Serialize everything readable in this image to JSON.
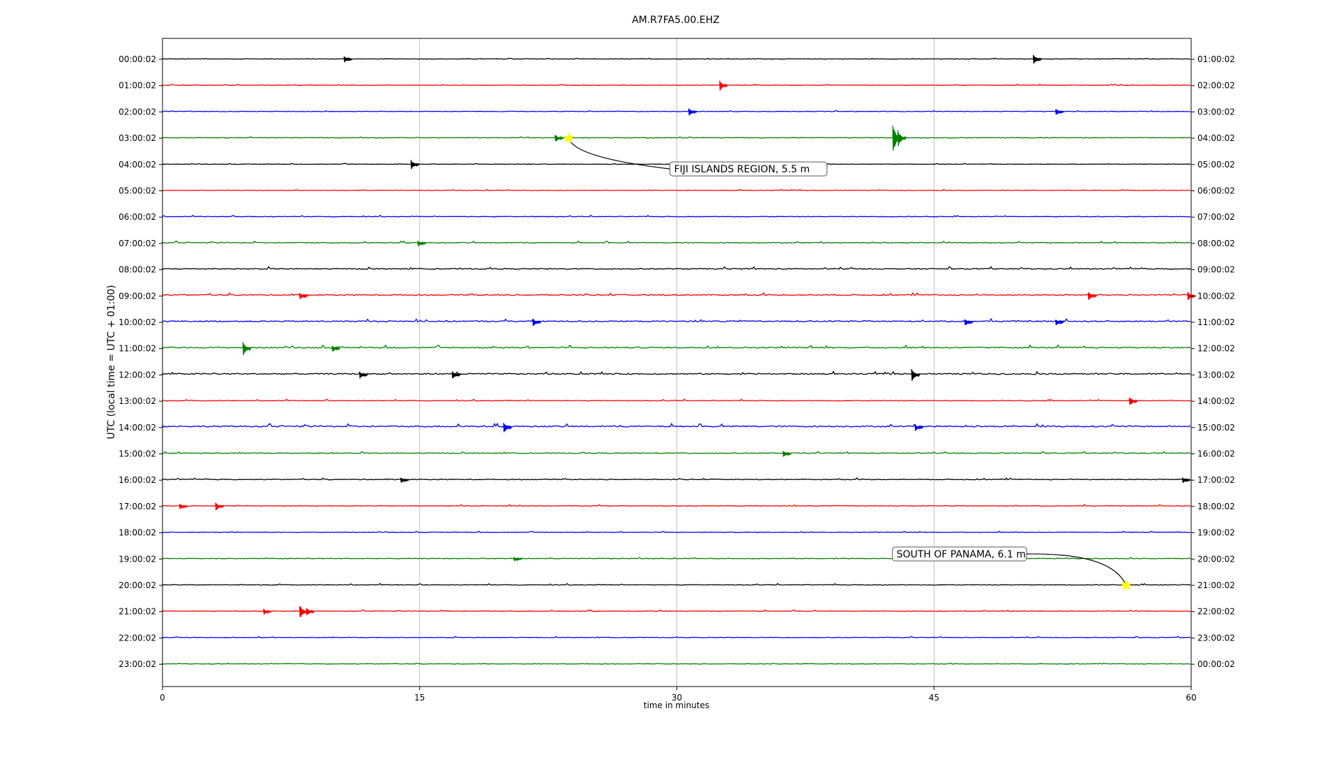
{
  "chart_data": {
    "type": "line",
    "title": "AM.R7FA5.00.EHZ",
    "xlabel": "time in minutes",
    "ylabel": "UTC (local time = UTC + 01:00)",
    "xlim": [
      0,
      60
    ],
    "x_ticks": [
      "0",
      "15",
      "30",
      "45",
      "60"
    ],
    "x_tick_values": [
      0,
      15,
      30,
      45,
      60
    ],
    "grid": "vertical",
    "trace_colors": [
      "#000000",
      "#ff0000",
      "#0000ff",
      "#008000"
    ],
    "left_labels": [
      "00:00:02",
      "01:00:02",
      "02:00:02",
      "03:00:02",
      "04:00:02",
      "05:00:02",
      "06:00:02",
      "07:00:02",
      "08:00:02",
      "09:00:02",
      "10:00:02",
      "11:00:02",
      "12:00:02",
      "13:00:02",
      "14:00:02",
      "15:00:02",
      "16:00:02",
      "17:00:02",
      "18:00:02",
      "19:00:02",
      "20:00:02",
      "21:00:02",
      "22:00:02",
      "23:00:02"
    ],
    "right_labels": [
      "01:00:02",
      "02:00:02",
      "03:00:02",
      "04:00:02",
      "05:00:02",
      "06:00:02",
      "07:00:02",
      "08:00:02",
      "09:00:02",
      "10:00:02",
      "11:00:02",
      "12:00:02",
      "13:00:02",
      "14:00:02",
      "15:00:02",
      "16:00:02",
      "17:00:02",
      "18:00:02",
      "19:00:02",
      "20:00:02",
      "21:00:02",
      "22:00:02",
      "23:00:02",
      "00:00:02"
    ],
    "noise_levels": [
      0.6,
      0.7,
      0.8,
      0.8,
      0.6,
      0.8,
      0.9,
      1.2,
      1.5,
      1.8,
      1.8,
      1.8,
      1.8,
      1.0,
      2.0,
      1.2,
      1.2,
      1.0,
      0.8,
      0.9,
      0.9,
      0.9,
      0.8,
      0.7
    ],
    "spikes": [
      {
        "trace": 0,
        "minute": 10.6,
        "amp": 5
      },
      {
        "trace": 0,
        "minute": 50.8,
        "amp": 8
      },
      {
        "trace": 1,
        "minute": 32.5,
        "amp": 7
      },
      {
        "trace": 2,
        "minute": 30.7,
        "amp": 6
      },
      {
        "trace": 2,
        "minute": 52.1,
        "amp": 5
      },
      {
        "trace": 3,
        "minute": 22.9,
        "amp": 6
      },
      {
        "trace": 3,
        "minute": 42.6,
        "amp": 22
      },
      {
        "trace": 3,
        "minute": 42.9,
        "amp": 12
      },
      {
        "trace": 4,
        "minute": 14.5,
        "amp": 7
      },
      {
        "trace": 7,
        "minute": 14.9,
        "amp": 4
      },
      {
        "trace": 9,
        "minute": 8.0,
        "amp": 5
      },
      {
        "trace": 9,
        "minute": 54.0,
        "amp": 6
      },
      {
        "trace": 9,
        "minute": 59.8,
        "amp": 6
      },
      {
        "trace": 10,
        "minute": 21.6,
        "amp": 6
      },
      {
        "trace": 10,
        "minute": 46.8,
        "amp": 5
      },
      {
        "trace": 10,
        "minute": 52.1,
        "amp": 5
      },
      {
        "trace": 11,
        "minute": 4.7,
        "amp": 10
      },
      {
        "trace": 11,
        "minute": 9.9,
        "amp": 5
      },
      {
        "trace": 12,
        "minute": 11.5,
        "amp": 5
      },
      {
        "trace": 12,
        "minute": 16.9,
        "amp": 6
      },
      {
        "trace": 12,
        "minute": 43.7,
        "amp": 10
      },
      {
        "trace": 13,
        "minute": 56.4,
        "amp": 7
      },
      {
        "trace": 14,
        "minute": 19.9,
        "amp": 7
      },
      {
        "trace": 14,
        "minute": 43.9,
        "amp": 5
      },
      {
        "trace": 15,
        "minute": 36.2,
        "amp": 5
      },
      {
        "trace": 16,
        "minute": 13.9,
        "amp": 4
      },
      {
        "trace": 16,
        "minute": 59.5,
        "amp": 4
      },
      {
        "trace": 17,
        "minute": 3.1,
        "amp": 6
      },
      {
        "trace": 17,
        "minute": 1.0,
        "amp": 4
      },
      {
        "trace": 19,
        "minute": 20.5,
        "amp": 3
      },
      {
        "trace": 21,
        "minute": 5.9,
        "amp": 4
      },
      {
        "trace": 21,
        "minute": 8.0,
        "amp": 10
      },
      {
        "trace": 21,
        "minute": 8.4,
        "amp": 6
      }
    ],
    "annotations": [
      {
        "label": "FIJI ISLANDS REGION, 5.5 m",
        "trace": 3,
        "minute": 23.7,
        "side": "right"
      },
      {
        "label": "SOUTH OF PANAMA, 6.1 m",
        "trace": 20,
        "minute": 56.2,
        "side": "left"
      }
    ],
    "marker_color": "#ffff00"
  }
}
